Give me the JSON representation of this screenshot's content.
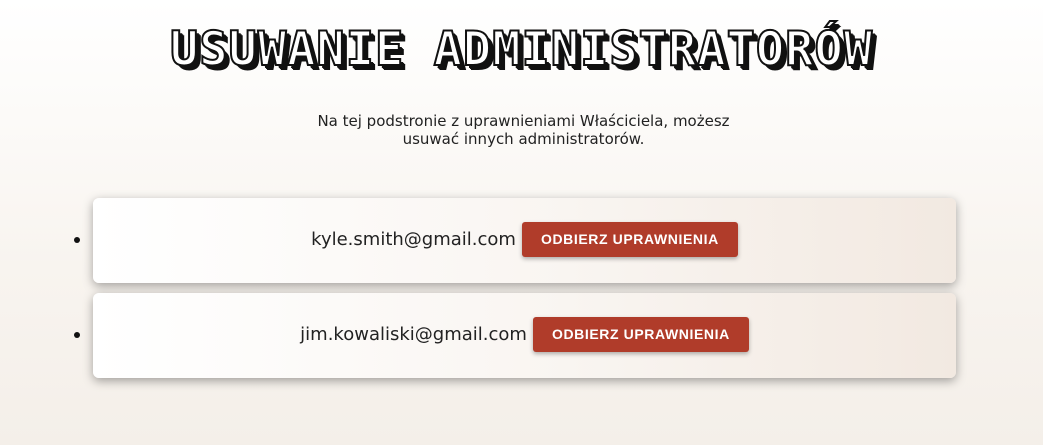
{
  "page": {
    "title": "USUWANIE ADMINISTRATORÓW",
    "description": "Na tej podstronie z uprawnieniami Właściciela, możesz usuwać innych administratorów."
  },
  "admins": [
    {
      "email": "kyle.smith@gmail.com",
      "action_label": "ODBIERZ UPRAWNIENIA"
    },
    {
      "email": "jim.kowaliski@gmail.com",
      "action_label": "ODBIERZ UPRAWNIENIA"
    }
  ],
  "colors": {
    "accent_button": "#b03c2a",
    "title_outline": "#111111"
  }
}
